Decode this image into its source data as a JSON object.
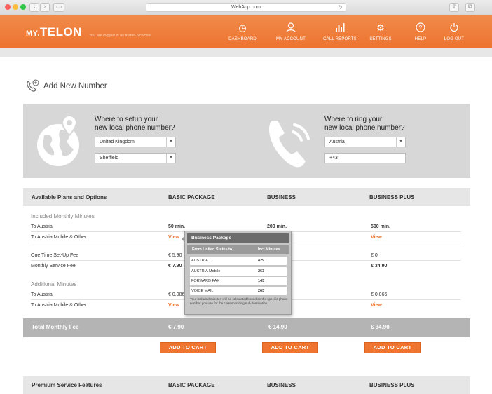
{
  "browser": {
    "url": "WebApp.com"
  },
  "header": {
    "logo_my": "MY.",
    "logo_telon": "TELON",
    "login_info": "You are logged in as Instan Scoicher",
    "nav": [
      {
        "label": "DASHBOARD",
        "icon": "dashboard-icon"
      },
      {
        "label": "MY ACCOUNT",
        "icon": "user-icon"
      },
      {
        "label": "CALL REPORTS",
        "icon": "bar-chart-icon"
      },
      {
        "label": "SETTINGS",
        "icon": "gear-icon"
      },
      {
        "label": "HELP",
        "icon": "help-icon"
      },
      {
        "label": "LOG OUT",
        "icon": "power-icon"
      }
    ]
  },
  "page": {
    "title": "Add New Number"
  },
  "setup": {
    "left_question_1": "Where to setup your",
    "left_question_2": "new local phone number?",
    "country": "United Kingdom",
    "city": "Sheffield",
    "right_question_1": "Where to ring your",
    "right_question_2": "new local phone number?",
    "ring_country": "Austria",
    "ring_prefix": "+43"
  },
  "plans": {
    "header": [
      "Available Plans and Options",
      "BASIC PACKAGE",
      "BUSINESS",
      "BUSINESS PLUS"
    ],
    "included_title": "Included Monthly Minutes",
    "to_austria": "To Austria",
    "to_austria_mobile": "To Austria Mobile & Other",
    "setup_fee": "One Time Set-Up Fee",
    "monthly_fee": "Monthly Service Fee",
    "additional_title": "Additional Minutes",
    "basic": {
      "minutes": "50 min.",
      "mobile": "View",
      "setup": "€ 5.90",
      "monthly": "€ 7.90",
      "add_austria": "€ 0.086",
      "add_mobile": "View"
    },
    "business": {
      "minutes": "200 min."
    },
    "plus": {
      "minutes": "500 min.",
      "mobile": "View",
      "setup": "€ 0",
      "monthly": "€ 34.90",
      "add_austria": "€ 0.066",
      "add_mobile": "View"
    },
    "total_label": "Total Monthly Fee",
    "totals": [
      "€ 7.90",
      "€ 14.90",
      "€ 34.90"
    ],
    "cart_label": "ADD TO CART"
  },
  "popover": {
    "title": "Business Package",
    "col1": "From United States to",
    "col2": "Incl.Minutes",
    "rows": [
      {
        "dest": "AUSTRIA",
        "min": "429"
      },
      {
        "dest": "AUSTRIA Mobile",
        "min": "263"
      },
      {
        "dest": "FORWARD FAX",
        "min": "145"
      },
      {
        "dest": "VOICE MAIL",
        "min": "263"
      }
    ],
    "note": "Your included minutes will be calculated based on the specific phone number you use for the corresponding sub-destination."
  },
  "premium": {
    "header": [
      "Premium Service Features",
      "BASIC PACKAGE",
      "BUSINESS",
      "BUSINESS PLUS"
    ]
  },
  "colors": {
    "accent": "#ee7430",
    "panel": "#d7d7d7",
    "total_bar": "#b4b4b4"
  }
}
